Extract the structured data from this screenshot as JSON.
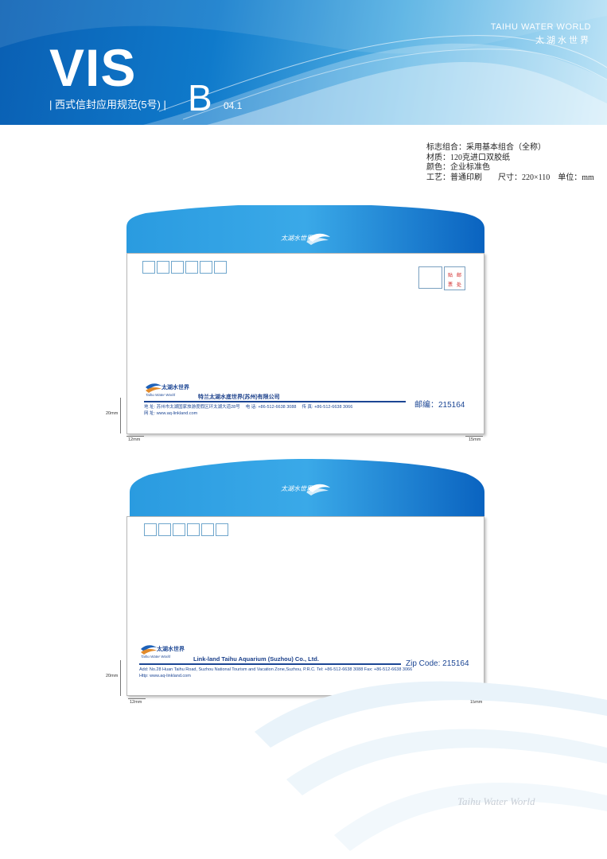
{
  "header": {
    "vis": "VIS",
    "subtitle": "| 西式信封应用规范(5号) |",
    "section_letter": "B",
    "section_code": "04.1",
    "brand_en": "TAIHU WATER WORLD",
    "brand_cn": "太湖水世界"
  },
  "specs": [
    "标志组合：采用基本组合（全称）",
    "材质：120克进口双胶纸",
    "颜色：企业标准色",
    "工艺：普通印刷　　尺寸：220×110　单位：mm"
  ],
  "envelope_cn": {
    "logo_cn": "太湖水世界",
    "logo_en": "Taihu Water World",
    "company": "特兰太湖水底世界(苏州)有限公司",
    "zip": "邮编：215164",
    "stamp_label_1": "贴",
    "stamp_label_2": "邮",
    "stamp_label_3": "票",
    "stamp_label_4": "处",
    "address": "地 址: 苏州市太湖国家旅游度假区环太湖大道28号　 电 话: +86-512-6638 3088　 传 真: +86-512-6638 3066",
    "website": "网 址: www.aq-linkland.com",
    "dim_left": "20mm",
    "dim_bottom_left": "12mm",
    "dim_bottom_right": "15mm"
  },
  "envelope_en": {
    "logo_cn": "太湖水世界",
    "logo_en": "Taihu Water World",
    "company": "Link-land Taihu Aquarium (Suzhou) Co., Ltd.",
    "zip": "Zip Code:  215164",
    "address": "Add: No.28 Huan Taihu Road, Suzhou National Tourism and Vacation Zone,Suzhou, P.R.C.  Tel: +86-512-6638 3088  Fax: +86-512-6638 3066",
    "website": "Http: www.aq-linkland.com",
    "dim_left": "20mm",
    "dim_bottom_left": "12mm",
    "dim_bottom_right": "15mm"
  },
  "footer": {
    "watermark": "Taihu Water World"
  },
  "colors": {
    "brand_blue": "#0f6fc4",
    "text_blue": "#1c4694"
  }
}
